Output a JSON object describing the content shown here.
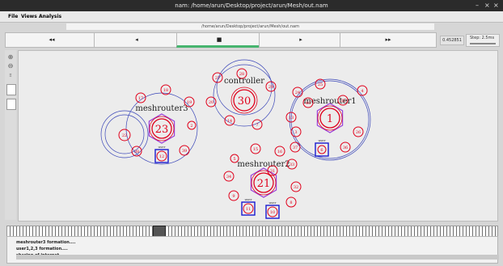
{
  "window": {
    "title": "nam: /home/arun/Desktop/project/arun/Mesh/out.nam",
    "minimize": "–",
    "maximize": "×",
    "close": "×"
  },
  "menubar": {
    "file": "File",
    "views": "Views",
    "analysis": "Analysis"
  },
  "path_label": "/home/arun/Desktop/project/arun/Mesh/out.nam",
  "controls": {
    "rewind": "◂◂",
    "back": "◂",
    "stop": "■",
    "play": "▸",
    "fastforward": "▸▸"
  },
  "time_display": "0.452851",
  "step_label": "Step: 2.5ms",
  "colors": {
    "node": "#e0001b",
    "hexagon": "#9a3fd8",
    "range": "#3a46b8",
    "box": "#1a1ad0",
    "label": "#222222"
  },
  "nodes": [
    {
      "label": "30"
    },
    {
      "label": "23"
    },
    {
      "label": "1"
    },
    {
      "label": "21"
    },
    {
      "label": "22"
    },
    {
      "label": "12"
    },
    {
      "label": "13"
    },
    {
      "label": "24"
    },
    {
      "label": "25"
    },
    {
      "label": "26"
    },
    {
      "label": "27"
    },
    {
      "label": "28"
    },
    {
      "label": "29"
    },
    {
      "label": "2"
    },
    {
      "label": "3"
    },
    {
      "label": "4"
    },
    {
      "label": "5"
    },
    {
      "label": "6"
    },
    {
      "label": "7"
    },
    {
      "label": "8"
    },
    {
      "label": "9"
    },
    {
      "label": "10"
    },
    {
      "label": "11"
    },
    {
      "label": "14"
    },
    {
      "label": "15"
    },
    {
      "label": "16"
    },
    {
      "label": "17"
    },
    {
      "label": "18"
    },
    {
      "label": "19"
    },
    {
      "label": "20"
    },
    {
      "label": "31"
    },
    {
      "label": "32"
    },
    {
      "label": "33"
    },
    {
      "label": "34"
    },
    {
      "label": "35"
    },
    {
      "label": "36"
    },
    {
      "label": "37"
    },
    {
      "label": "38"
    },
    {
      "label": "39"
    },
    {
      "label": "40"
    }
  ],
  "node_names": {
    "controller": "controller",
    "meshrouter1": "meshrouter1",
    "meshrouter2": "meshrouter2",
    "meshrouter3": "meshrouter3"
  },
  "box_nodes": [
    {
      "label": "12",
      "tag": "user"
    },
    {
      "label": "6",
      "tag": "user"
    },
    {
      "label": "11",
      "tag": "user"
    },
    {
      "label": "10",
      "tag": "user"
    }
  ],
  "annotations": [
    "meshrouter3 formation....",
    "user1,2,3 formation....",
    "sharing of internet...."
  ]
}
